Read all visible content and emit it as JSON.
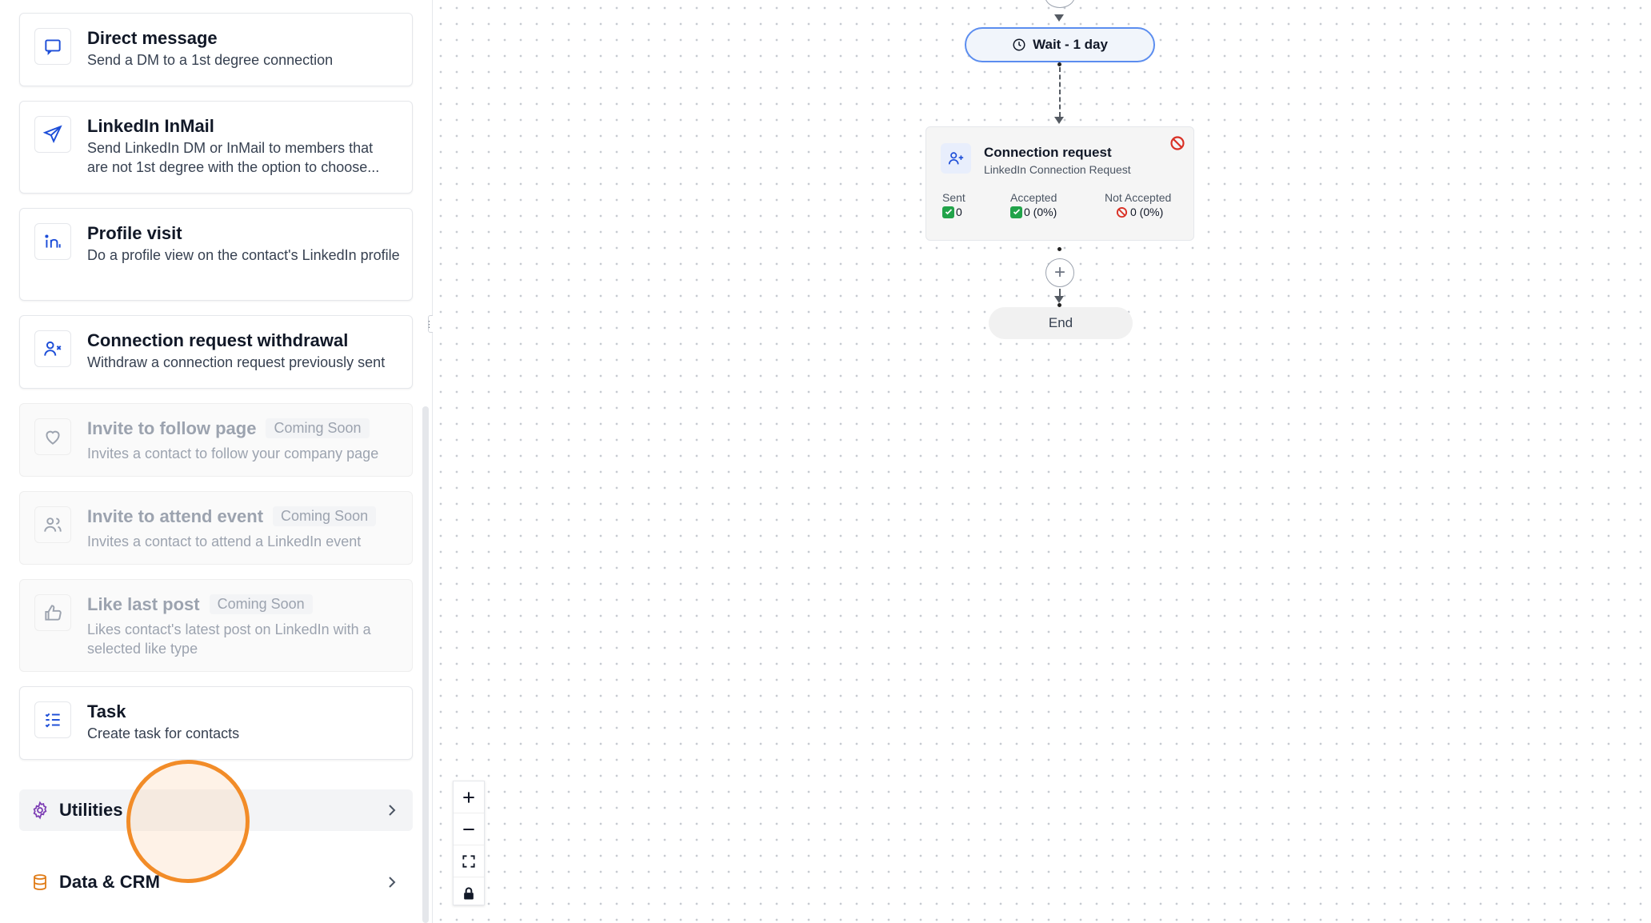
{
  "actions": [
    {
      "id": "direct-message",
      "title": "Direct message",
      "desc": "Send a DM to a 1st degree connection",
      "icon": "chat-bubble-icon"
    },
    {
      "id": "linkedin-inmail",
      "title": "LinkedIn InMail",
      "desc": "Send LinkedIn DM or InMail to members that are not 1st degree with the option to choose...",
      "icon": "send-icon"
    },
    {
      "id": "profile-visit",
      "title": "Profile visit",
      "desc": "Do a profile view on the contact's LinkedIn profile",
      "icon": "linkedin-icon"
    },
    {
      "id": "connection-request-withdrawal",
      "title": "Connection request withdrawal",
      "desc": "Withdraw a connection request previously sent",
      "icon": "user-remove-icon"
    },
    {
      "id": "invite-to-follow-page",
      "title": "Invite to follow page",
      "badge": "Coming Soon",
      "desc": "Invites a contact to follow your company page",
      "icon": "heart-icon"
    },
    {
      "id": "invite-to-attend-event",
      "title": "Invite to attend event",
      "badge": "Coming Soon",
      "desc": "Invites a contact to attend a LinkedIn event",
      "icon": "users-icon"
    },
    {
      "id": "like-last-post",
      "title": "Like last post",
      "badge": "Coming Soon",
      "desc": "Likes contact's latest post on LinkedIn with a selected like type",
      "icon": "thumbs-up-icon"
    },
    {
      "id": "task",
      "title": "Task",
      "desc": "Create task for contacts",
      "icon": "checklist-icon"
    }
  ],
  "sections": {
    "utilities": "Utilities",
    "data_crm": "Data & CRM"
  },
  "canvas": {
    "wait_label": "Wait - 1 day",
    "connection": {
      "title": "Connection request",
      "subtitle": "LinkedIn Connection Request",
      "sent_label": "Sent",
      "sent_value": "0",
      "accepted_label": "Accepted",
      "accepted_value": "0 (0%)",
      "not_accepted_label": "Not Accepted",
      "not_accepted_value": "0 (0%)"
    },
    "end_label": "End",
    "add_step": "+"
  },
  "colors": {
    "accent_blue": "#5b8def",
    "success_green": "#22a34a",
    "error_red": "#d93025",
    "utilities_purple": "#7e3fb5",
    "data_orange": "#e07b16",
    "cursor_orange": "#f28c28"
  }
}
